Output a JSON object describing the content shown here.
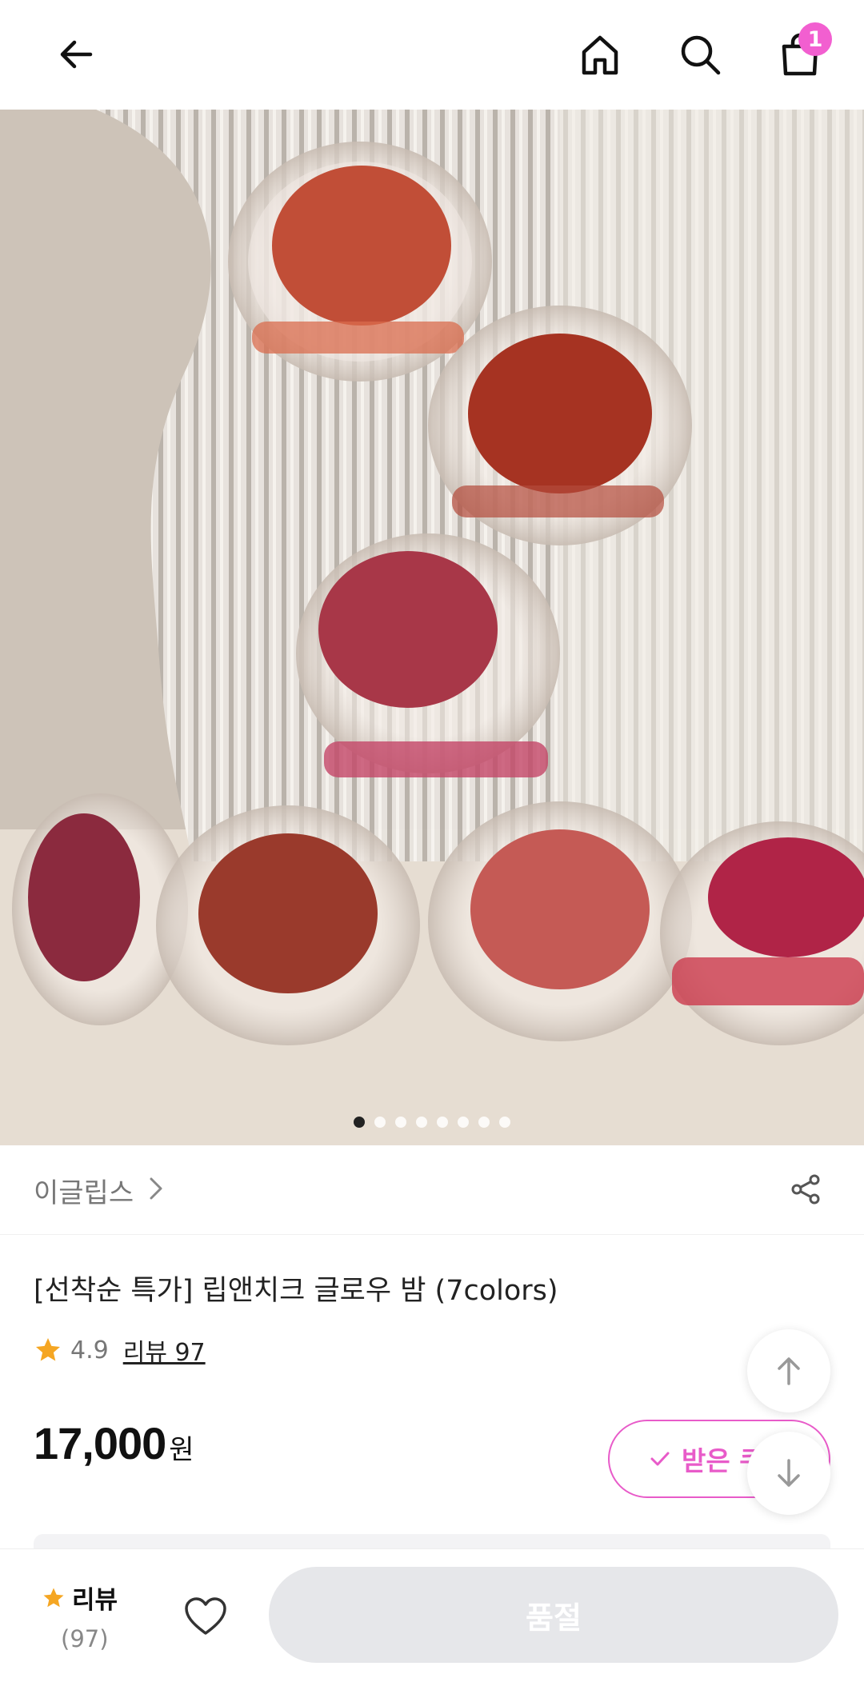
{
  "header": {
    "icons": [
      "arrow-left-icon",
      "home-icon",
      "search-icon",
      "shopping-bag-icon"
    ],
    "cart_badge": "1",
    "badge_color": "#f25fd0"
  },
  "hero": {
    "image_index": 1,
    "image_count": 8
  },
  "brand": {
    "name": "이글립스",
    "chevron_icon": "chevron-right-icon",
    "share_icon": "share-icon"
  },
  "product": {
    "title": "[선착순 특가] 립앤치크 글로우 밤 (7colors)",
    "rating": "4.9",
    "rating_stars": 4.9,
    "review_link": "리뷰 97",
    "price": "17,000",
    "currency": "원"
  },
  "coupon": {
    "label": "받은 쿠",
    "icon": "check-icon",
    "accent_color": "#e85bc9"
  },
  "floating": {
    "up_icon": "arrow-up-icon",
    "down_icon": "arrow-down-icon"
  },
  "bottom_bar": {
    "review_label": "리뷰",
    "review_count": "(97)",
    "heart_icon": "heart-icon",
    "soldout_label": "품절",
    "star_color": "#f5a623"
  }
}
